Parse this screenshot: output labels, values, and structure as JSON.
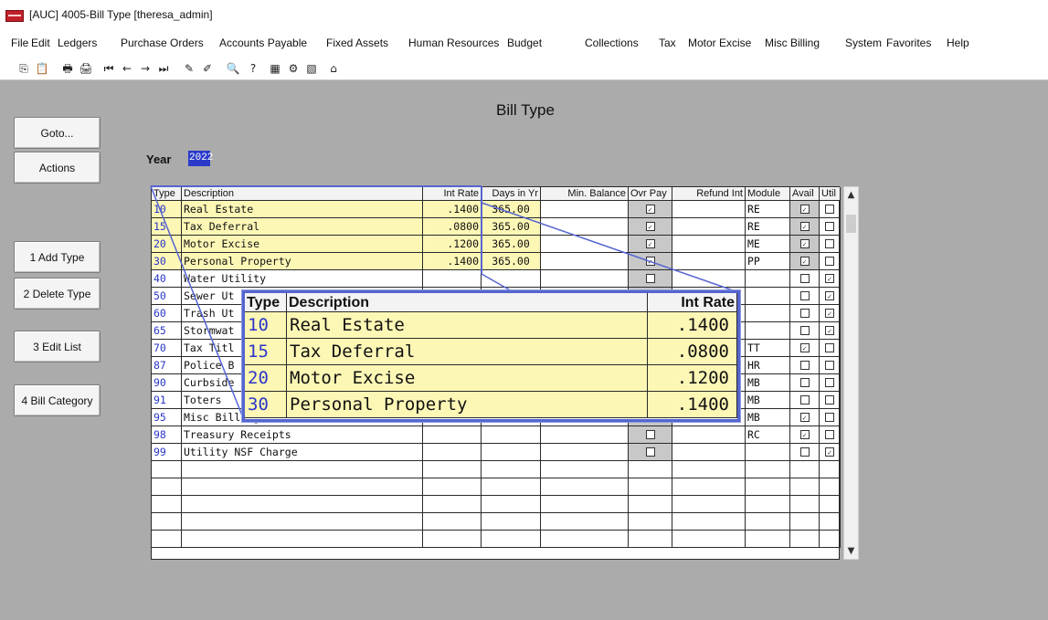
{
  "window": {
    "title": "[AUC] 4005-Bill Type [theresa_admin]"
  },
  "menu": [
    "File",
    "Edit",
    "Ledgers",
    "Purchase Orders",
    "Accounts Payable",
    "Fixed Assets",
    "Human Resources",
    "Budget",
    "Collections",
    "Tax",
    "Motor Excise",
    "Misc Billing",
    "System",
    "Favorites",
    "Help"
  ],
  "toolbar": [
    {
      "icon": "copy-icon",
      "glyph": "⎘"
    },
    {
      "icon": "paste-icon",
      "glyph": "📋"
    },
    {
      "icon": "print-icon",
      "glyph": "🖶"
    },
    {
      "icon": "print-setup-icon",
      "glyph": "🖨"
    },
    {
      "icon": "first-record-icon",
      "glyph": "⏮"
    },
    {
      "icon": "previous-record-icon",
      "glyph": "←"
    },
    {
      "icon": "next-record-icon",
      "glyph": "→"
    },
    {
      "icon": "last-record-icon",
      "glyph": "⏭"
    },
    {
      "icon": "edit-icon",
      "glyph": "✎"
    },
    {
      "icon": "edit-off-icon",
      "glyph": "✐"
    },
    {
      "icon": "search-icon",
      "glyph": "🔍"
    },
    {
      "icon": "help-pointer-icon",
      "glyph": "?"
    },
    {
      "icon": "spreadsheet-icon",
      "glyph": "▦"
    },
    {
      "icon": "properties-icon",
      "glyph": "⚙"
    },
    {
      "icon": "report-icon",
      "glyph": "▧"
    },
    {
      "icon": "home-icon",
      "glyph": "⌂"
    }
  ],
  "sidebar": {
    "goto": "Goto...",
    "actions": "Actions",
    "add_type": "1 Add Type",
    "delete_type": "2 Delete Type",
    "edit_list": "3 Edit List",
    "bill_category": "4 Bill Category"
  },
  "page": {
    "title": "Bill Type",
    "year_label": "Year",
    "year_value": "2022"
  },
  "grid": {
    "headers": [
      "Type",
      "Description",
      "Int Rate",
      "Days in Yr",
      "Min. Balance",
      "Ovr Pay",
      "Refund Int",
      "Module",
      "Avail",
      "Util"
    ],
    "rows": [
      {
        "type": "10",
        "description": "Real Estate",
        "int_rate": ".1400",
        "days": "365.00",
        "min_balance": "",
        "ovr_pay": true,
        "refund_int": "",
        "module": "RE",
        "avail": true,
        "util": false
      },
      {
        "type": "15",
        "description": "Tax Deferral",
        "int_rate": ".0800",
        "days": "365.00",
        "min_balance": "",
        "ovr_pay": true,
        "refund_int": "",
        "module": "RE",
        "avail": true,
        "util": false
      },
      {
        "type": "20",
        "description": "Motor Excise",
        "int_rate": ".1200",
        "days": "365.00",
        "min_balance": "",
        "ovr_pay": true,
        "refund_int": "",
        "module": "ME",
        "avail": true,
        "util": false
      },
      {
        "type": "30",
        "description": "Personal Property",
        "int_rate": ".1400",
        "days": "365.00",
        "min_balance": "",
        "ovr_pay": true,
        "refund_int": "",
        "module": "PP",
        "avail": true,
        "util": false
      },
      {
        "type": "40",
        "description": "Water Utility",
        "int_rate": "",
        "days": "",
        "min_balance": "",
        "ovr_pay": false,
        "refund_int": "",
        "module": "",
        "avail": false,
        "util": true
      },
      {
        "type": "50",
        "description": "Sewer Ut",
        "int_rate": "",
        "days": "",
        "min_balance": "",
        "ovr_pay": false,
        "refund_int": "",
        "module": "",
        "avail": false,
        "util": true
      },
      {
        "type": "60",
        "description": "Trash Ut",
        "int_rate": "",
        "days": "",
        "min_balance": "",
        "ovr_pay": false,
        "refund_int": "",
        "module": "",
        "avail": false,
        "util": true
      },
      {
        "type": "65",
        "description": "Stormwat",
        "int_rate": "",
        "days": "",
        "min_balance": "",
        "ovr_pay": false,
        "refund_int": "",
        "module": "",
        "avail": false,
        "util": true
      },
      {
        "type": "70",
        "description": "Tax Titl",
        "int_rate": "",
        "days": "",
        "min_balance": "",
        "ovr_pay": false,
        "refund_int": "",
        "module": "TT",
        "avail": true,
        "util": false
      },
      {
        "type": "87",
        "description": "Police B",
        "int_rate": "",
        "days": "",
        "min_balance": "",
        "ovr_pay": false,
        "refund_int": "",
        "module": "HR",
        "avail": false,
        "util": false
      },
      {
        "type": "90",
        "description": "Curbside",
        "int_rate": "",
        "days": "",
        "min_balance": "",
        "ovr_pay": false,
        "refund_int": "",
        "module": "MB",
        "avail": false,
        "util": false
      },
      {
        "type": "91",
        "description": "Toters",
        "int_rate": "",
        "days": "",
        "min_balance": "",
        "ovr_pay": false,
        "refund_int": "",
        "module": "MB",
        "avail": false,
        "util": false
      },
      {
        "type": "95",
        "description": "Misc Billing",
        "int_rate": "",
        "days": "",
        "min_balance": "",
        "ovr_pay": false,
        "refund_int": "",
        "module": "MB",
        "avail": true,
        "util": false
      },
      {
        "type": "98",
        "description": "Treasury Receipts",
        "int_rate": "",
        "days": "",
        "min_balance": "",
        "ovr_pay": false,
        "refund_int": "",
        "module": "RC",
        "avail": true,
        "util": false
      },
      {
        "type": "99",
        "description": "Utility NSF Charge",
        "int_rate": "",
        "days": "",
        "min_balance": "",
        "ovr_pay": false,
        "refund_int": "",
        "module": "",
        "avail": false,
        "util": true
      }
    ],
    "empty_rows": 5
  },
  "zoom": {
    "headers": [
      "Type",
      "Description",
      "Int Rate"
    ],
    "rows": [
      {
        "type": "10",
        "description": "Real Estate",
        "int_rate": ".1400"
      },
      {
        "type": "15",
        "description": "Tax Deferral",
        "int_rate": ".0800"
      },
      {
        "type": "20",
        "description": "Motor Excise",
        "int_rate": ".1200"
      },
      {
        "type": "30",
        "description": "Personal Property",
        "int_rate": ".1400"
      }
    ]
  },
  "colors": {
    "highlight_row": "#fdf7b6",
    "type_text": "#2a36c8",
    "callout_border": "#5565cf",
    "workspace": "#ababab"
  }
}
